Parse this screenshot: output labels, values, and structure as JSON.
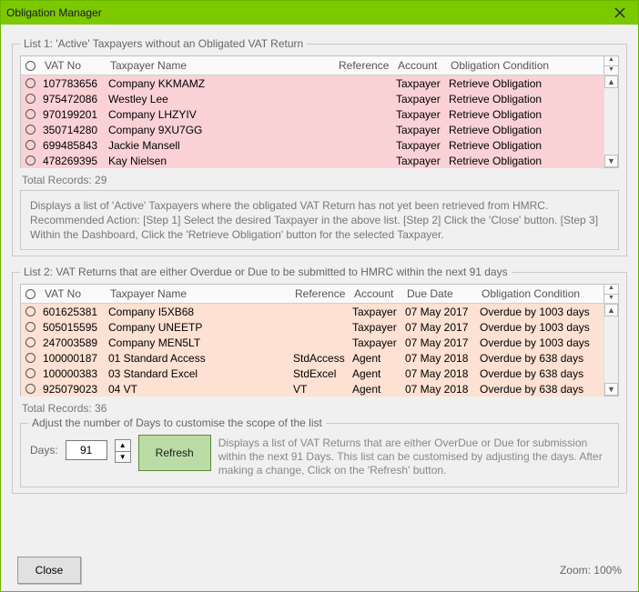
{
  "window": {
    "title": "Obligation Manager"
  },
  "list1": {
    "legend": "List 1:  'Active' Taxpayers without an Obligated VAT Return",
    "headers": {
      "vat": "VAT No",
      "name": "Taxpayer Name",
      "ref": "Reference",
      "acct": "Account",
      "obl": "Obligation Condition"
    },
    "rows": [
      {
        "vat": "107783656",
        "name": "Company KKMAMZ",
        "ref": "",
        "acct": "Taxpayer",
        "obl": "Retrieve Obligation"
      },
      {
        "vat": "975472086",
        "name": "Westley Lee",
        "ref": "",
        "acct": "Taxpayer",
        "obl": "Retrieve Obligation"
      },
      {
        "vat": "970199201",
        "name": "Company LHZYIV",
        "ref": "",
        "acct": "Taxpayer",
        "obl": "Retrieve Obligation"
      },
      {
        "vat": "350714280",
        "name": "Company 9XU7GG",
        "ref": "",
        "acct": "Taxpayer",
        "obl": "Retrieve Obligation"
      },
      {
        "vat": "699485843",
        "name": "Jackie Mansell",
        "ref": "",
        "acct": "Taxpayer",
        "obl": "Retrieve Obligation"
      },
      {
        "vat": "478269395",
        "name": "Kay Nielsen",
        "ref": "",
        "acct": "Taxpayer",
        "obl": "Retrieve Obligation"
      }
    ],
    "total": "Total Records: 29",
    "info": "Displays a list of 'Active' Taxpayers where the obligated VAT Return has not yet been retrieved from HMRC. Recommended Action: [Step 1] Select the desired Taxpayer in the above list. [Step 2] Click the 'Close' button. [Step 3] Within the Dashboard, Click the 'Retrieve Obligation' button for the selected Taxpayer."
  },
  "list2": {
    "legend": "List 2:  VAT Returns that are either Overdue or Due to be submitted to HMRC within the next 91 days",
    "headers": {
      "vat": "VAT No",
      "name": "Taxpayer Name",
      "ref": "Reference",
      "acct": "Account",
      "due": "Due Date",
      "obl": "Obligation Condition"
    },
    "rows": [
      {
        "vat": "601625381",
        "name": "Company I5XB68",
        "ref": "",
        "acct": "Taxpayer",
        "due": "07 May 2017",
        "obl": "Overdue by 1003 days"
      },
      {
        "vat": "505015595",
        "name": "Company UNEETP",
        "ref": "",
        "acct": "Taxpayer",
        "due": "07 May 2017",
        "obl": "Overdue by 1003 days"
      },
      {
        "vat": "247003589",
        "name": "Company MEN5LT",
        "ref": "",
        "acct": "Taxpayer",
        "due": "07 May 2017",
        "obl": "Overdue by 1003 days"
      },
      {
        "vat": "100000187",
        "name": "01 Standard Access",
        "ref": "StdAccess",
        "acct": "Agent",
        "due": "07 May 2018",
        "obl": "Overdue by 638 days"
      },
      {
        "vat": "100000383",
        "name": "03 Standard Excel",
        "ref": "StdExcel",
        "acct": "Agent",
        "due": "07 May 2018",
        "obl": "Overdue by 638 days"
      },
      {
        "vat": "925079023",
        "name": "04 VT",
        "ref": "VT",
        "acct": "Agent",
        "due": "07 May 2018",
        "obl": "Overdue by 638 days"
      }
    ],
    "total": "Total Records: 36",
    "adjust": {
      "legend": "Adjust the number of Days to customise the scope of the list",
      "days_label": "Days:",
      "days_value": "91",
      "refresh": "Refresh",
      "desc": "Displays a list of VAT Returns that are either OverDue or Due for submission within the next 91 Days. This list can be customised by adjusting the days. After making a change, Click on the 'Refresh' button."
    }
  },
  "footer": {
    "close": "Close",
    "zoom": "Zoom: 100%"
  }
}
